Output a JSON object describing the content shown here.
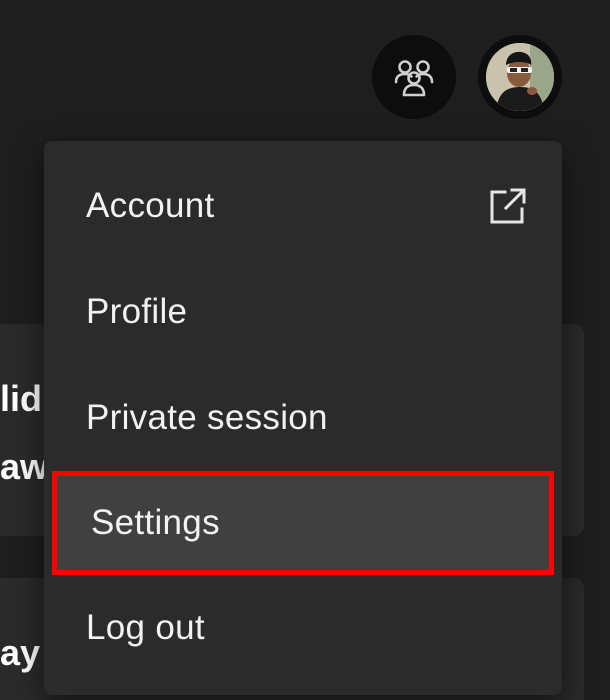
{
  "header": {
    "friend_activity_icon": "friends-icon",
    "avatar_icon": "user-avatar"
  },
  "background": {
    "line1": "lid",
    "line2": "aw",
    "line3": "ay"
  },
  "menu": {
    "items": [
      {
        "label": "Account",
        "icon": "external-link-icon"
      },
      {
        "label": "Profile"
      },
      {
        "label": "Private session"
      },
      {
        "label": "Settings",
        "highlighted": true
      },
      {
        "label": "Log out"
      }
    ]
  },
  "colors": {
    "background": "#1e1e1e",
    "menu_bg": "#2b2b2b",
    "highlight_bg": "#404040",
    "highlight_border": "#ff0000"
  }
}
